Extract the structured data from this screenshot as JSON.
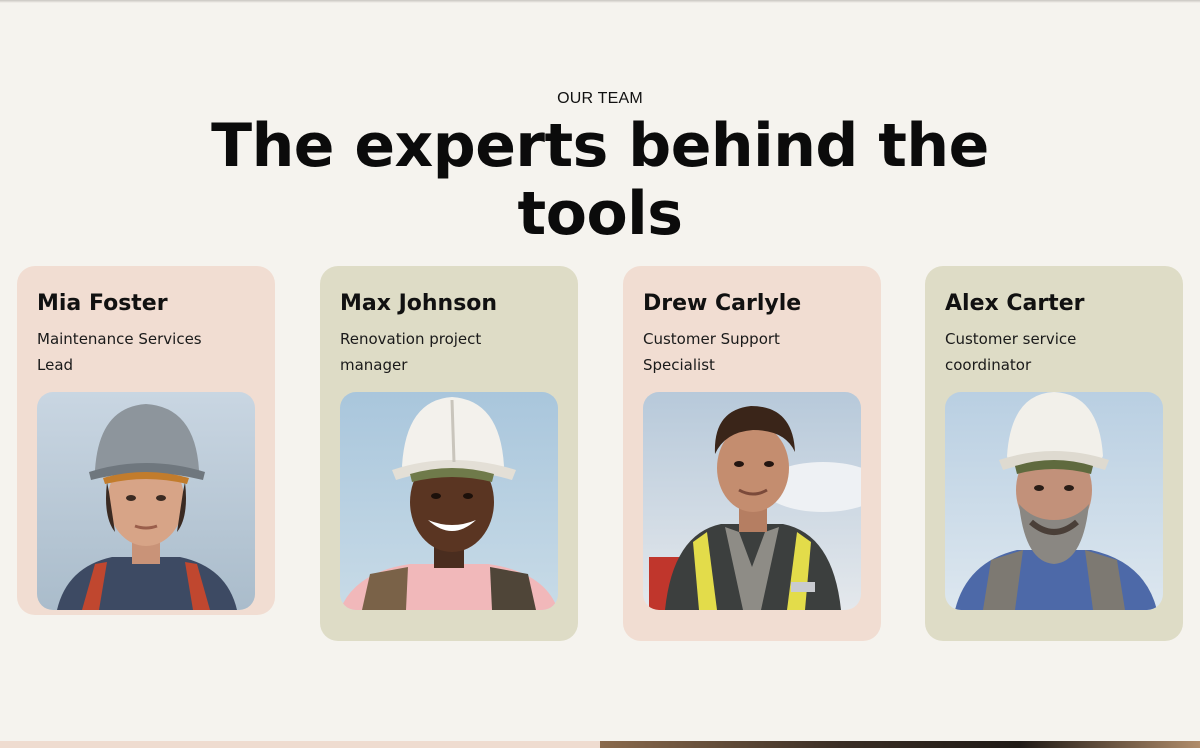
{
  "section": {
    "eyebrow": "OUR TEAM",
    "heading": "The experts behind the tools"
  },
  "team": [
    {
      "name": "Mia Foster",
      "role": "Maintenance Services Lead",
      "photo_icon": "worker-portrait-woman-gray-helmet",
      "card_color": "#f1ddd2"
    },
    {
      "name": "Max Johnson",
      "role": "Renovation project manager",
      "photo_icon": "worker-portrait-man-white-helmet-smiling",
      "card_color": "#dedcc6"
    },
    {
      "name": "Drew Carlyle",
      "role": "Customer Support Specialist",
      "photo_icon": "worker-portrait-man-safety-vest",
      "card_color": "#f1ddd2"
    },
    {
      "name": "Alex Carter",
      "role": "Customer service coordinator",
      "photo_icon": "worker-portrait-bearded-man-white-helmet",
      "card_color": "#dedcc6"
    }
  ]
}
